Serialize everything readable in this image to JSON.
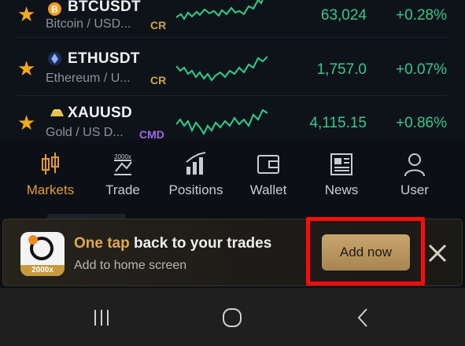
{
  "markets": [
    {
      "symbol": "BTCUSDT",
      "description": "Bitcoin / USD...",
      "tag": "CR",
      "tag_color": "#c9a74a",
      "price": "63,024",
      "change": "+0.28%",
      "icon": "bitcoin-icon",
      "icon_color": "#f39c1f"
    },
    {
      "symbol": "ETHUSDT",
      "description": "Ethereum / U...",
      "tag": "CR",
      "tag_color": "#c9a74a",
      "price": "1,757.0",
      "change": "+0.07%",
      "icon": "ethereum-icon",
      "icon_color": "#3d5fb3"
    },
    {
      "symbol": "XAUUSD",
      "description": "Gold / US D...",
      "tag": "CMD",
      "tag_color": "#9f6ae6",
      "price": "4,115.15",
      "change": "+0.86%",
      "icon": "gold-bar-icon",
      "icon_color": "#e8c24a"
    }
  ],
  "bottom_nav": [
    {
      "label": "Markets",
      "icon": "candlestick-icon",
      "active": true
    },
    {
      "label": "Trade",
      "icon": "trade-leverage-icon",
      "active": false
    },
    {
      "label": "Positions",
      "icon": "bar-chart-icon",
      "active": false
    },
    {
      "label": "Wallet",
      "icon": "wallet-icon",
      "active": false
    },
    {
      "label": "News",
      "icon": "newspaper-icon",
      "active": false
    },
    {
      "label": "User",
      "icon": "user-icon",
      "active": false
    }
  ],
  "banner": {
    "title_highlight": "One tap",
    "title_rest": " back to your trades",
    "subtitle": "Add to home screen",
    "add_button": "Add now",
    "app_icon_badge": "2000x"
  },
  "colors": {
    "up": "#38c88a",
    "accent": "#e49a33",
    "highlight": "#ff0a0a"
  }
}
